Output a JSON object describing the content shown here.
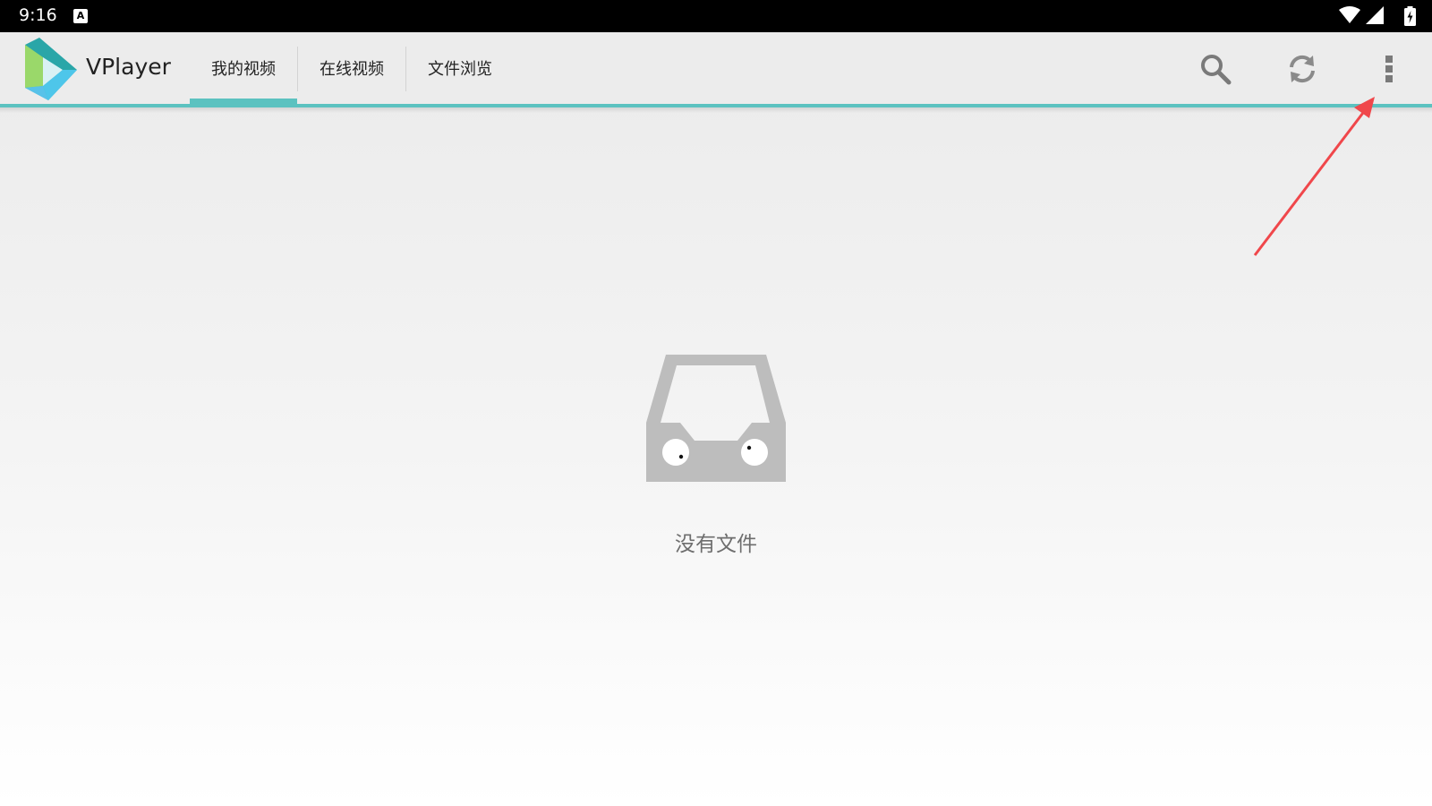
{
  "status_bar": {
    "time": "9:16",
    "notification_icon_letter": "A",
    "icons": [
      "wifi-icon",
      "cell-signal-icon",
      "battery-charging-icon"
    ]
  },
  "app_bar": {
    "title": "VPlayer",
    "logo_icon": "vplayer-logo-icon",
    "tabs": [
      {
        "label": "我的视频",
        "selected": true
      },
      {
        "label": "在线视频",
        "selected": false
      },
      {
        "label": "文件浏览",
        "selected": false
      }
    ],
    "actions": [
      "search-icon",
      "refresh-icon",
      "overflow-menu-icon"
    ],
    "accent_color": "#5cc2c0"
  },
  "empty_state": {
    "icon": "empty-inbox-icon",
    "message": "没有文件"
  },
  "annotation": {
    "type": "arrow",
    "color": "#f0474b",
    "target": "overflow-menu-icon"
  }
}
